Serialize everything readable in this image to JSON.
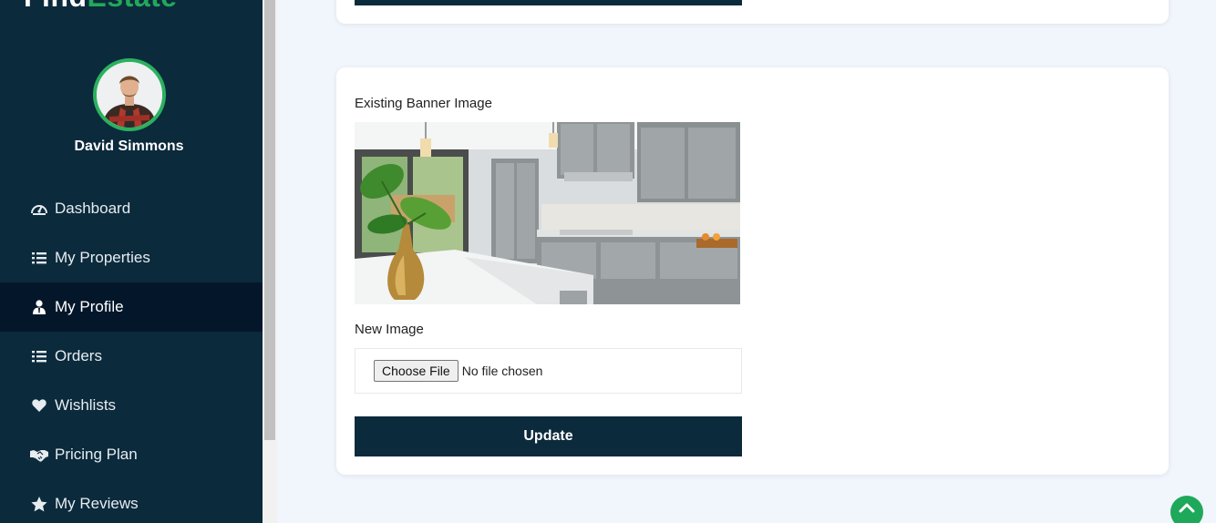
{
  "brand": {
    "part1": "Find",
    "part2": "Estate"
  },
  "user": {
    "name": "David Simmons"
  },
  "nav": [
    {
      "label": "Dashboard",
      "icon": "dashboard-gauge-icon",
      "active": false
    },
    {
      "label": "My Properties",
      "icon": "list-icon",
      "active": false
    },
    {
      "label": "My Profile",
      "icon": "user-tie-icon",
      "active": true
    },
    {
      "label": "Orders",
      "icon": "list-icon",
      "active": false
    },
    {
      "label": "Wishlists",
      "icon": "heart-icon",
      "active": false
    },
    {
      "label": "Pricing Plan",
      "icon": "handshake-icon",
      "active": false
    },
    {
      "label": "My Reviews",
      "icon": "star-icon",
      "active": false
    }
  ],
  "banner_form": {
    "existing_label": "Existing Banner Image",
    "new_label": "New Image",
    "choose_file": "Choose File",
    "file_status": "No file chosen",
    "submit": "Update"
  },
  "colors": {
    "sidebar": "#0b2a3c",
    "active": "#04172a",
    "accent": "#22a85a",
    "page_bg": "#f1f5fc"
  }
}
